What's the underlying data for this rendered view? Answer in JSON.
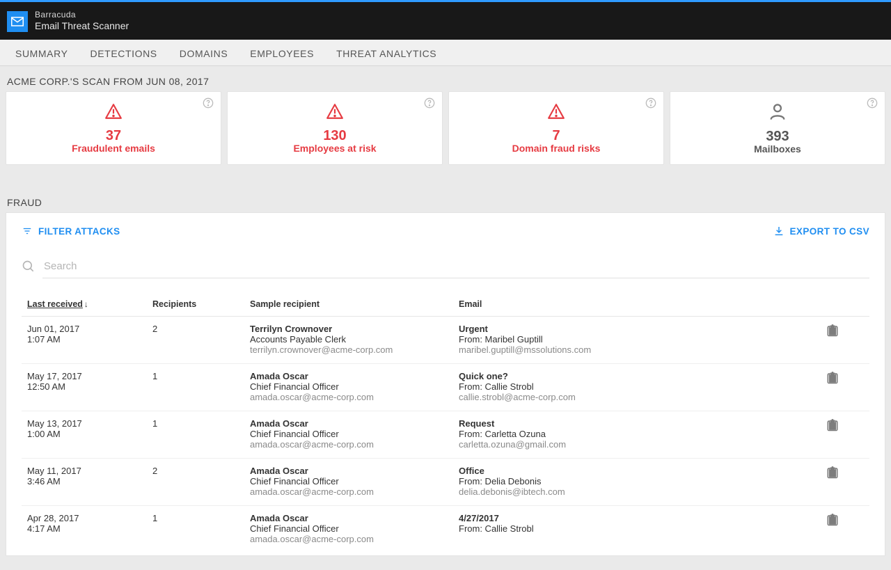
{
  "header": {
    "brand": "Barracuda",
    "product": "Email Threat Scanner"
  },
  "nav": {
    "items": [
      "SUMMARY",
      "DETECTIONS",
      "DOMAINS",
      "EMPLOYEES",
      "THREAT ANALYTICS"
    ]
  },
  "scan_title": "ACME CORP.'S SCAN FROM JUN 08, 2017",
  "cards": [
    {
      "value": "37",
      "label": "Fraudulent emails",
      "variant": "red",
      "icon": "alert"
    },
    {
      "value": "130",
      "label": "Employees at risk",
      "variant": "red",
      "icon": "alert"
    },
    {
      "value": "7",
      "label": "Domain fraud risks",
      "variant": "red",
      "icon": "alert"
    },
    {
      "value": "393",
      "label": "Mailboxes",
      "variant": "gray",
      "icon": "person"
    }
  ],
  "fraud": {
    "title": "FRAUD",
    "filter_label": "FILTER ATTACKS",
    "export_label": "EXPORT TO CSV",
    "search_placeholder": "Search",
    "columns": {
      "last_received": "Last received",
      "recipients": "Recipients",
      "sample_recipient": "Sample recipient",
      "email": "Email"
    },
    "rows": [
      {
        "date": "Jun 01, 2017",
        "time": "1:07 AM",
        "recipients": "2",
        "name": "Terrilyn Crownover",
        "role": "Accounts Payable Clerk",
        "addr": "terrilyn.crownover@acme-corp.com",
        "subject": "Urgent",
        "from": "From: Maribel Guptill",
        "from_addr": "maribel.guptill@mssolutions.com"
      },
      {
        "date": "May 17, 2017",
        "time": "12:50 AM",
        "recipients": "1",
        "name": "Amada Oscar",
        "role": "Chief Financial Officer",
        "addr": "amada.oscar@acme-corp.com",
        "subject": "Quick one?",
        "from": "From: Callie Strobl",
        "from_addr": "callie.strobl@acme-corp.com"
      },
      {
        "date": "May 13, 2017",
        "time": "1:00 AM",
        "recipients": "1",
        "name": "Amada Oscar",
        "role": "Chief Financial Officer",
        "addr": "amada.oscar@acme-corp.com",
        "subject": "Request",
        "from": "From: Carletta Ozuna",
        "from_addr": "carletta.ozuna@gmail.com"
      },
      {
        "date": "May 11, 2017",
        "time": "3:46 AM",
        "recipients": "2",
        "name": "Amada Oscar",
        "role": "Chief Financial Officer",
        "addr": "amada.oscar@acme-corp.com",
        "subject": "Office",
        "from": "From: Delia Debonis",
        "from_addr": "delia.debonis@ibtech.com"
      },
      {
        "date": "Apr 28, 2017",
        "time": "4:17 AM",
        "recipients": "1",
        "name": "Amada Oscar",
        "role": "Chief Financial Officer",
        "addr": "amada.oscar@acme-corp.com",
        "subject": "4/27/2017",
        "from": "From: Callie Strobl",
        "from_addr": ""
      }
    ]
  }
}
